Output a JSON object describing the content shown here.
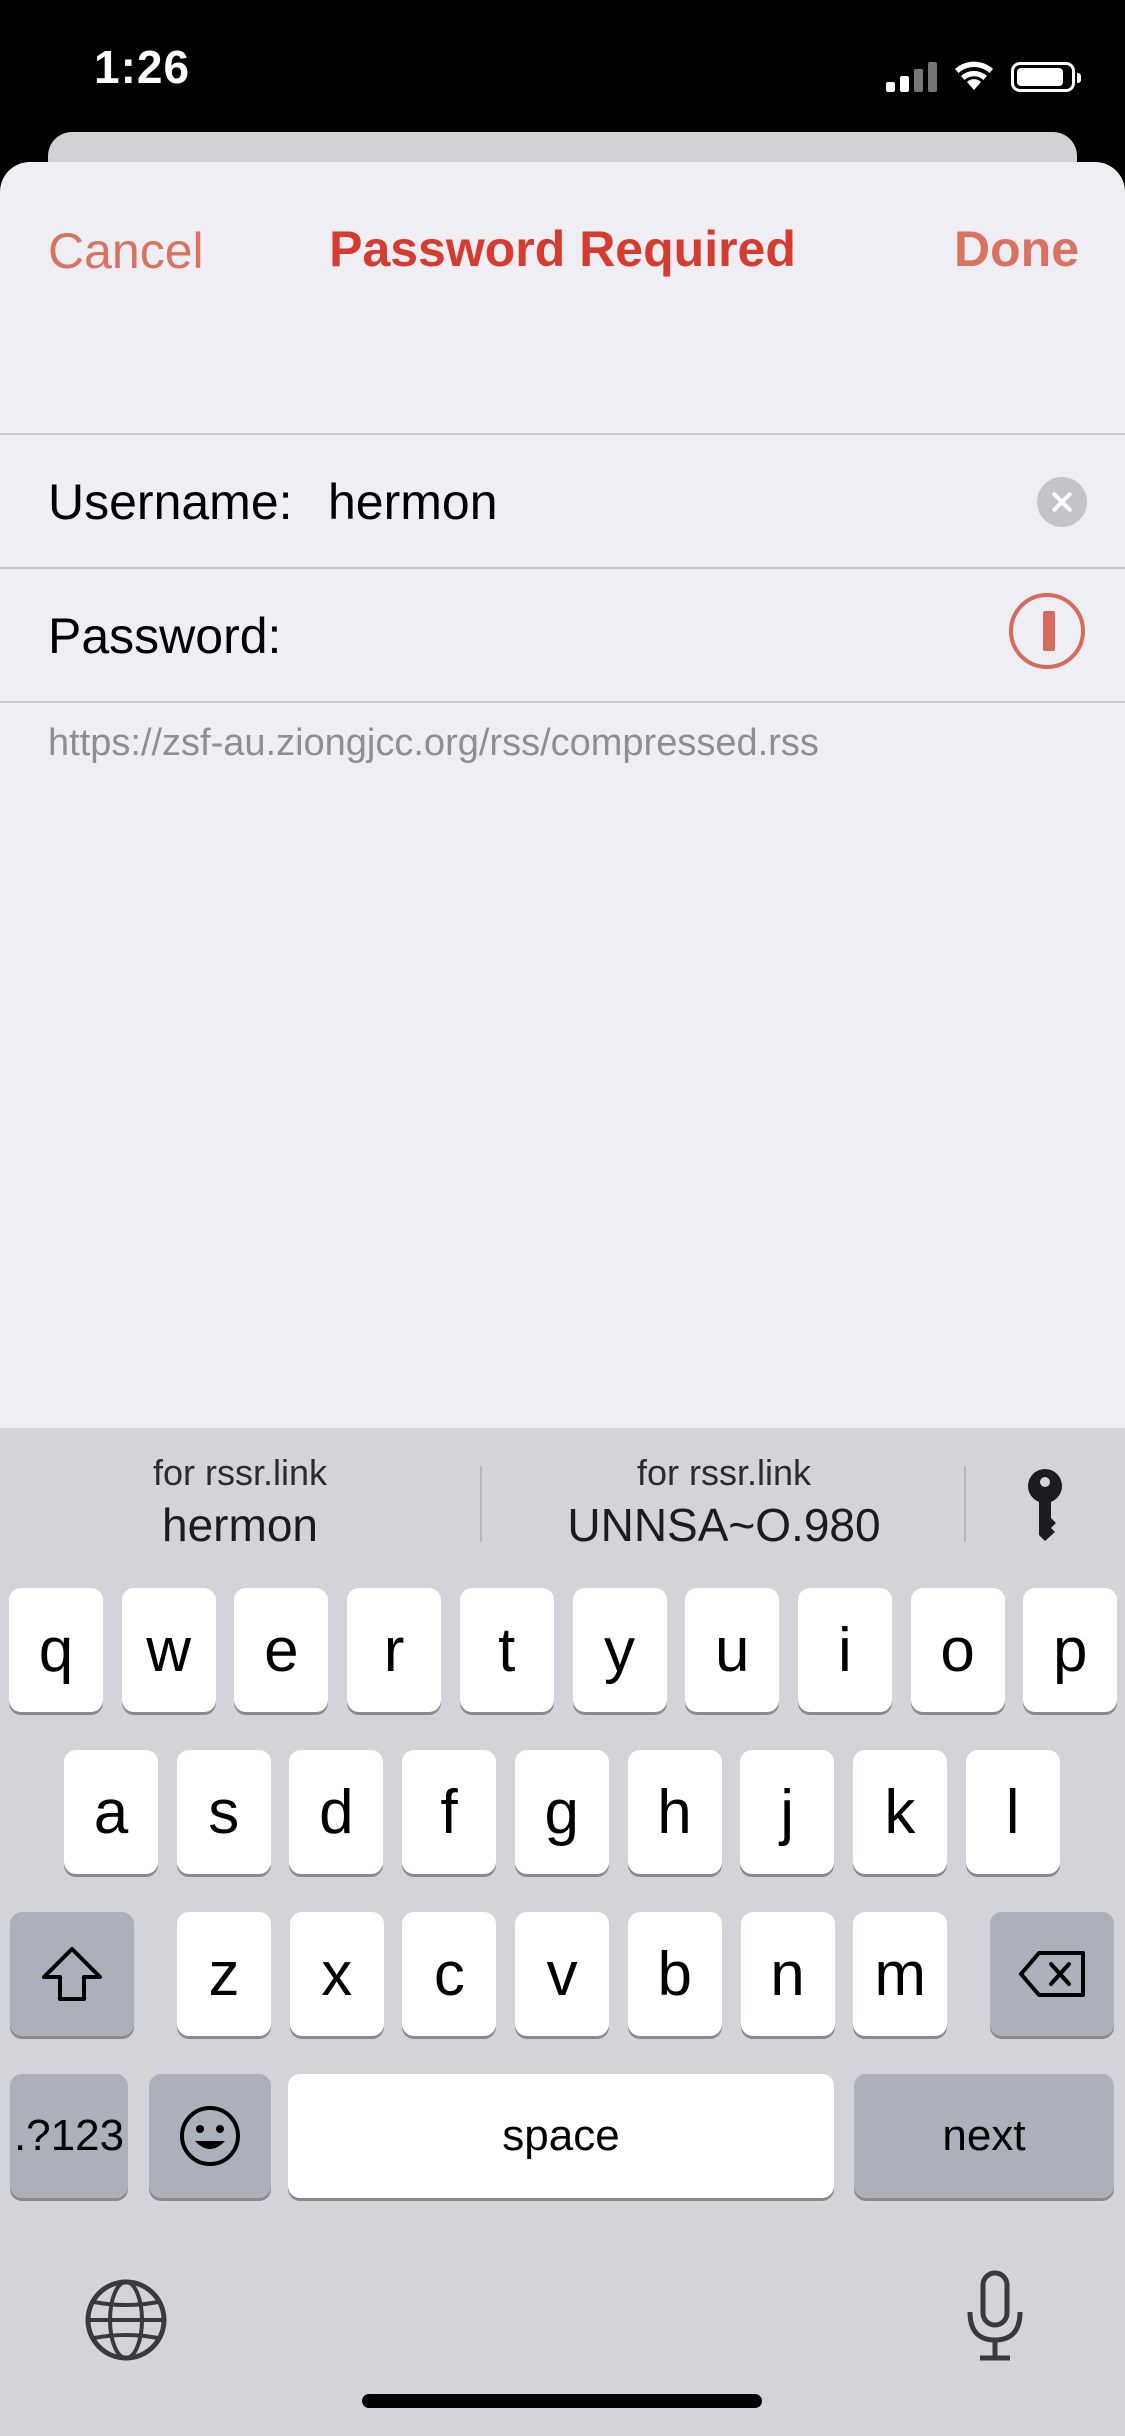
{
  "status": {
    "time": "1:26"
  },
  "nav": {
    "cancel": "Cancel",
    "title": "Password Required",
    "done": "Done"
  },
  "form": {
    "username_label": "Username:",
    "username_value": "hermon",
    "password_label": "Password:",
    "password_value": ""
  },
  "url": "https://zsf-au.ziongjcc.org/rss/compressed.rss",
  "suggestions": [
    {
      "site": "for rssr.link",
      "value": "hermon"
    },
    {
      "site": "for rssr.link",
      "value": "UNNSA~O.980"
    }
  ],
  "keyboard": {
    "row1": [
      "q",
      "w",
      "e",
      "r",
      "t",
      "y",
      "u",
      "i",
      "o",
      "p"
    ],
    "row2": [
      "a",
      "s",
      "d",
      "f",
      "g",
      "h",
      "j",
      "k",
      "l"
    ],
    "row3": [
      "z",
      "x",
      "c",
      "v",
      "b",
      "n",
      "m"
    ],
    "numbers": ".?123",
    "space": "space",
    "next": "next"
  },
  "colors": {
    "accent": "#d63b2f",
    "accent_light": "#d9735f"
  }
}
